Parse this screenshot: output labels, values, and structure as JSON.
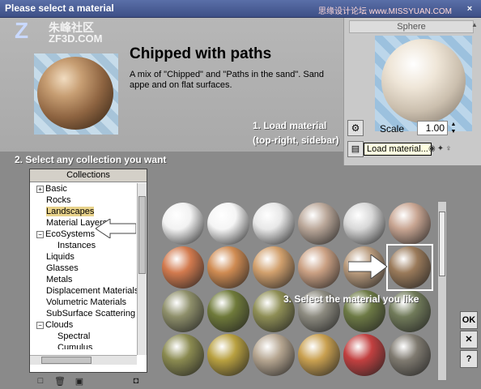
{
  "window": {
    "title": "Please select a material",
    "watermark": "思缘设计论坛  www.MISSYUAN.COM",
    "close": "×"
  },
  "logo": {
    "mark": "Z",
    "cn": "朱峰社区",
    "en": "ZF3D.COM"
  },
  "material": {
    "title": "Chipped with paths",
    "description": "A mix of \"Chipped\" and \"Paths in the sand\". Sand appe and on flat surfaces."
  },
  "annotations": {
    "step1": [
      "1. Load material",
      "(top-right, sidebar)"
    ],
    "step2": "2. Select any collection you want",
    "step3": "3. Select the material you like"
  },
  "sphere_panel": {
    "tab": "Sphere",
    "scale_label": "Scale",
    "scale_value": "1.00",
    "tooltip": "Load material...",
    "icons": [
      "load-material-icon",
      "folder-icon"
    ]
  },
  "collections": {
    "header": "Collections",
    "items": [
      {
        "label": "Basic",
        "box": "+",
        "indent": 0,
        "selected": false
      },
      {
        "label": "Rocks",
        "box": "",
        "indent": 0,
        "selected": false
      },
      {
        "label": "Landscapes",
        "box": "",
        "indent": 0,
        "selected": true
      },
      {
        "label": "Material Layers",
        "box": "",
        "indent": 0,
        "selected": false
      },
      {
        "label": "EcoSystems",
        "box": "−",
        "indent": 0,
        "selected": false
      },
      {
        "label": "Instances",
        "box": "",
        "indent": 1,
        "selected": false
      },
      {
        "label": "Liquids",
        "box": "",
        "indent": 0,
        "selected": false
      },
      {
        "label": "Glasses",
        "box": "",
        "indent": 0,
        "selected": false
      },
      {
        "label": "Metals",
        "box": "",
        "indent": 0,
        "selected": false
      },
      {
        "label": "Displacement Materials",
        "box": "",
        "indent": 0,
        "selected": false
      },
      {
        "label": "Volumetric Materials",
        "box": "",
        "indent": 0,
        "selected": false
      },
      {
        "label": "SubSurface Scattering",
        "box": "",
        "indent": 0,
        "selected": false
      },
      {
        "label": "Clouds",
        "box": "−",
        "indent": 0,
        "selected": false
      },
      {
        "label": "Spectral",
        "box": "",
        "indent": 1,
        "selected": false
      },
      {
        "label": "Cumulus",
        "box": "",
        "indent": 1,
        "selected": false
      }
    ],
    "tools": [
      "new-collection-icon",
      "delete-icon",
      "open-folder-icon",
      "info-icon"
    ]
  },
  "material_grid": {
    "colors": [
      [
        "#f2f2f2",
        "#f5f5f5",
        "#e8e8e8",
        "#bba89a",
        "#d8d8d8",
        "#c8a592"
      ],
      [
        "#d27a4e",
        "#cf8b52",
        "#d1a06d",
        "#caa083",
        "#b89a7c",
        "#9a7a5a"
      ],
      [
        "#8e8f6a",
        "#6f7a3a",
        "#8e8e55",
        "#8d8b80",
        "#6d7a45",
        "#717b5a"
      ],
      [
        "#8a8a50",
        "#b8a040",
        "#b5a590",
        "#c9a050",
        "#c24040",
        "#7f7a70"
      ]
    ],
    "selected": [
      1,
      5
    ]
  },
  "buttons": {
    "ok": "OK",
    "cancel": "✕",
    "help": "?"
  }
}
